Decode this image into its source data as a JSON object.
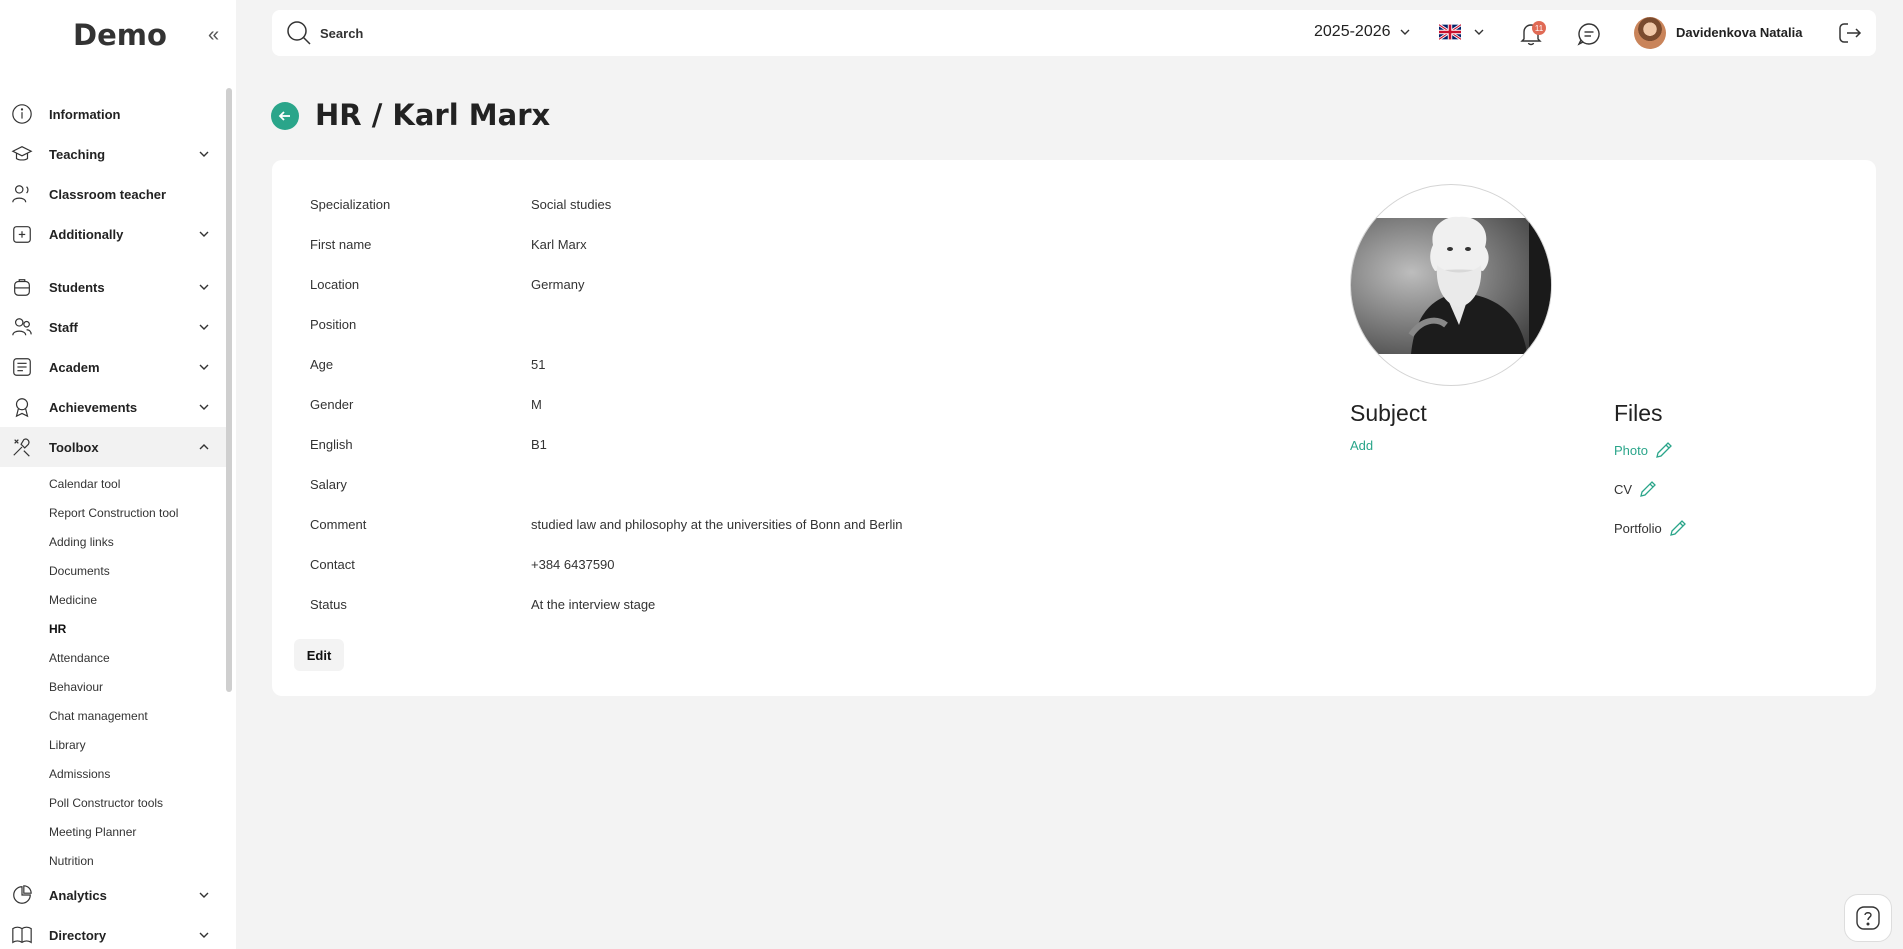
{
  "app": {
    "logo": "Demo"
  },
  "sidebar": {
    "items": [
      {
        "label": "Information"
      },
      {
        "label": "Teaching"
      },
      {
        "label": "Classroom teacher"
      },
      {
        "label": "Additionally"
      },
      {
        "label": "Students"
      },
      {
        "label": "Staff"
      },
      {
        "label": "Academ"
      },
      {
        "label": "Achievements"
      },
      {
        "label": "Toolbox"
      },
      {
        "label": "Analytics"
      },
      {
        "label": "Directory"
      }
    ],
    "toolbox_sub": [
      "Calendar tool",
      "Report Construction tool",
      "Adding links",
      "Documents",
      "Medicine",
      "HR",
      "Attendance",
      "Behaviour",
      "Chat management",
      "Library",
      "Admissions",
      "Poll Constructor tools",
      "Meeting Planner",
      "Nutrition"
    ]
  },
  "topbar": {
    "search_placeholder": "Search",
    "year": "2025-2026",
    "notifications_count": "11",
    "user_name": "Davidenkova Natalia"
  },
  "page": {
    "title": "HR / Karl Marx"
  },
  "profile": {
    "fields": [
      {
        "label": "Specialization",
        "value": "Social studies"
      },
      {
        "label": "First name",
        "value": "Karl Marx"
      },
      {
        "label": "Location",
        "value": "Germany"
      },
      {
        "label": "Position",
        "value": ""
      },
      {
        "label": "Age",
        "value": "51"
      },
      {
        "label": "Gender",
        "value": "M"
      },
      {
        "label": "English",
        "value": "B1"
      },
      {
        "label": "Salary",
        "value": ""
      },
      {
        "label": "Comment",
        "value": "studied law and philosophy at the universities of Bonn and Berlin"
      },
      {
        "label": "Contact",
        "value": "+384 6437590"
      },
      {
        "label": "Status",
        "value": "At the interview stage"
      }
    ],
    "edit_label": "Edit"
  },
  "subject": {
    "title": "Subject",
    "add_label": "Add"
  },
  "files": {
    "title": "Files",
    "items": [
      {
        "label": "Photo"
      },
      {
        "label": "CV"
      },
      {
        "label": "Portfolio"
      }
    ]
  },
  "colors": {
    "accent": "#2aa58a",
    "badge": "#e06a55",
    "background": "#f3f3f3"
  }
}
